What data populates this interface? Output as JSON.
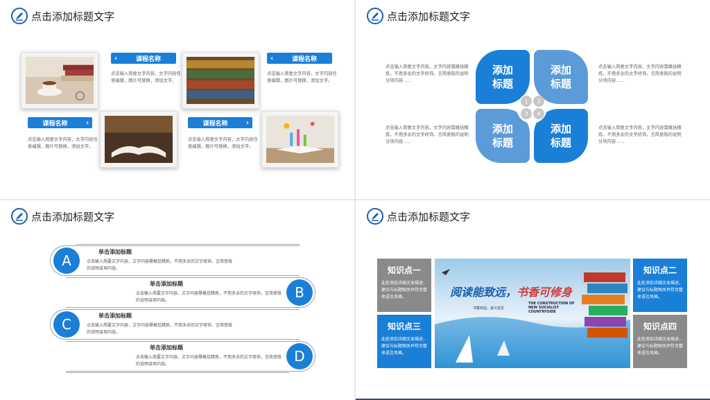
{
  "slide_title": "点击添加标题文字",
  "colors": {
    "accent": "#1a7fd6",
    "dark_accent": "#1a5fae",
    "gray": "#8a8a8a"
  },
  "icons": {
    "logo": "pen-in-circle-icon"
  },
  "slide1": {
    "pill_label": "课程名称",
    "desc": "点击输入简要文字内容，文字内容任意编辑，图片可替换，添加文字。"
  },
  "slide2": {
    "petal_label": "添加\n标题",
    "numbers": [
      "1",
      "2",
      "3",
      "4"
    ],
    "desc": "点击输入简要文字内容，文字内容需概括精炼，不用多余的文字修饰，言简意赅的说明分项内容......"
  },
  "slide3": {
    "rows": [
      {
        "letter": "A",
        "title": "单击添加标题",
        "desc": "点击输入简要文字内容，文字内容需概括精炼，不用多余的文字修饰，言简意赅的说明该项内容。"
      },
      {
        "letter": "B",
        "title": "单击添加标题",
        "desc": "点击输入简要文字内容，文字内容需概括精炼，不用多余的文字修饰，言简意赅的说明该项内容。"
      },
      {
        "letter": "C",
        "title": "单击添加标题",
        "desc": "点击输入简要文字内容，文字内容需概括精炼，不用多余的文字修饰，言简意赅的说明该项内容。"
      },
      {
        "letter": "D",
        "title": "单击添加标题",
        "desc": "点击输入简要文字内容，文字内容需概括精炼，不用多余的文字修饰，言简意赅的说明该项内容。"
      }
    ]
  },
  "slide4": {
    "k1": "知识点一",
    "k2": "知识点二",
    "k3": "知识点三",
    "k4": "知识点四",
    "kdesc": "此处添加详细文本描述，建议与标题相关并符合整体语言风格。",
    "banner_main_a": "阅读能致远，",
    "banner_main_b": "书香可修身",
    "banner_sub": "书香四溢，其义自见",
    "banner_en": "THE CONSTRUCTION OF NEW SOCIALIST COUNTRYSIDE"
  }
}
